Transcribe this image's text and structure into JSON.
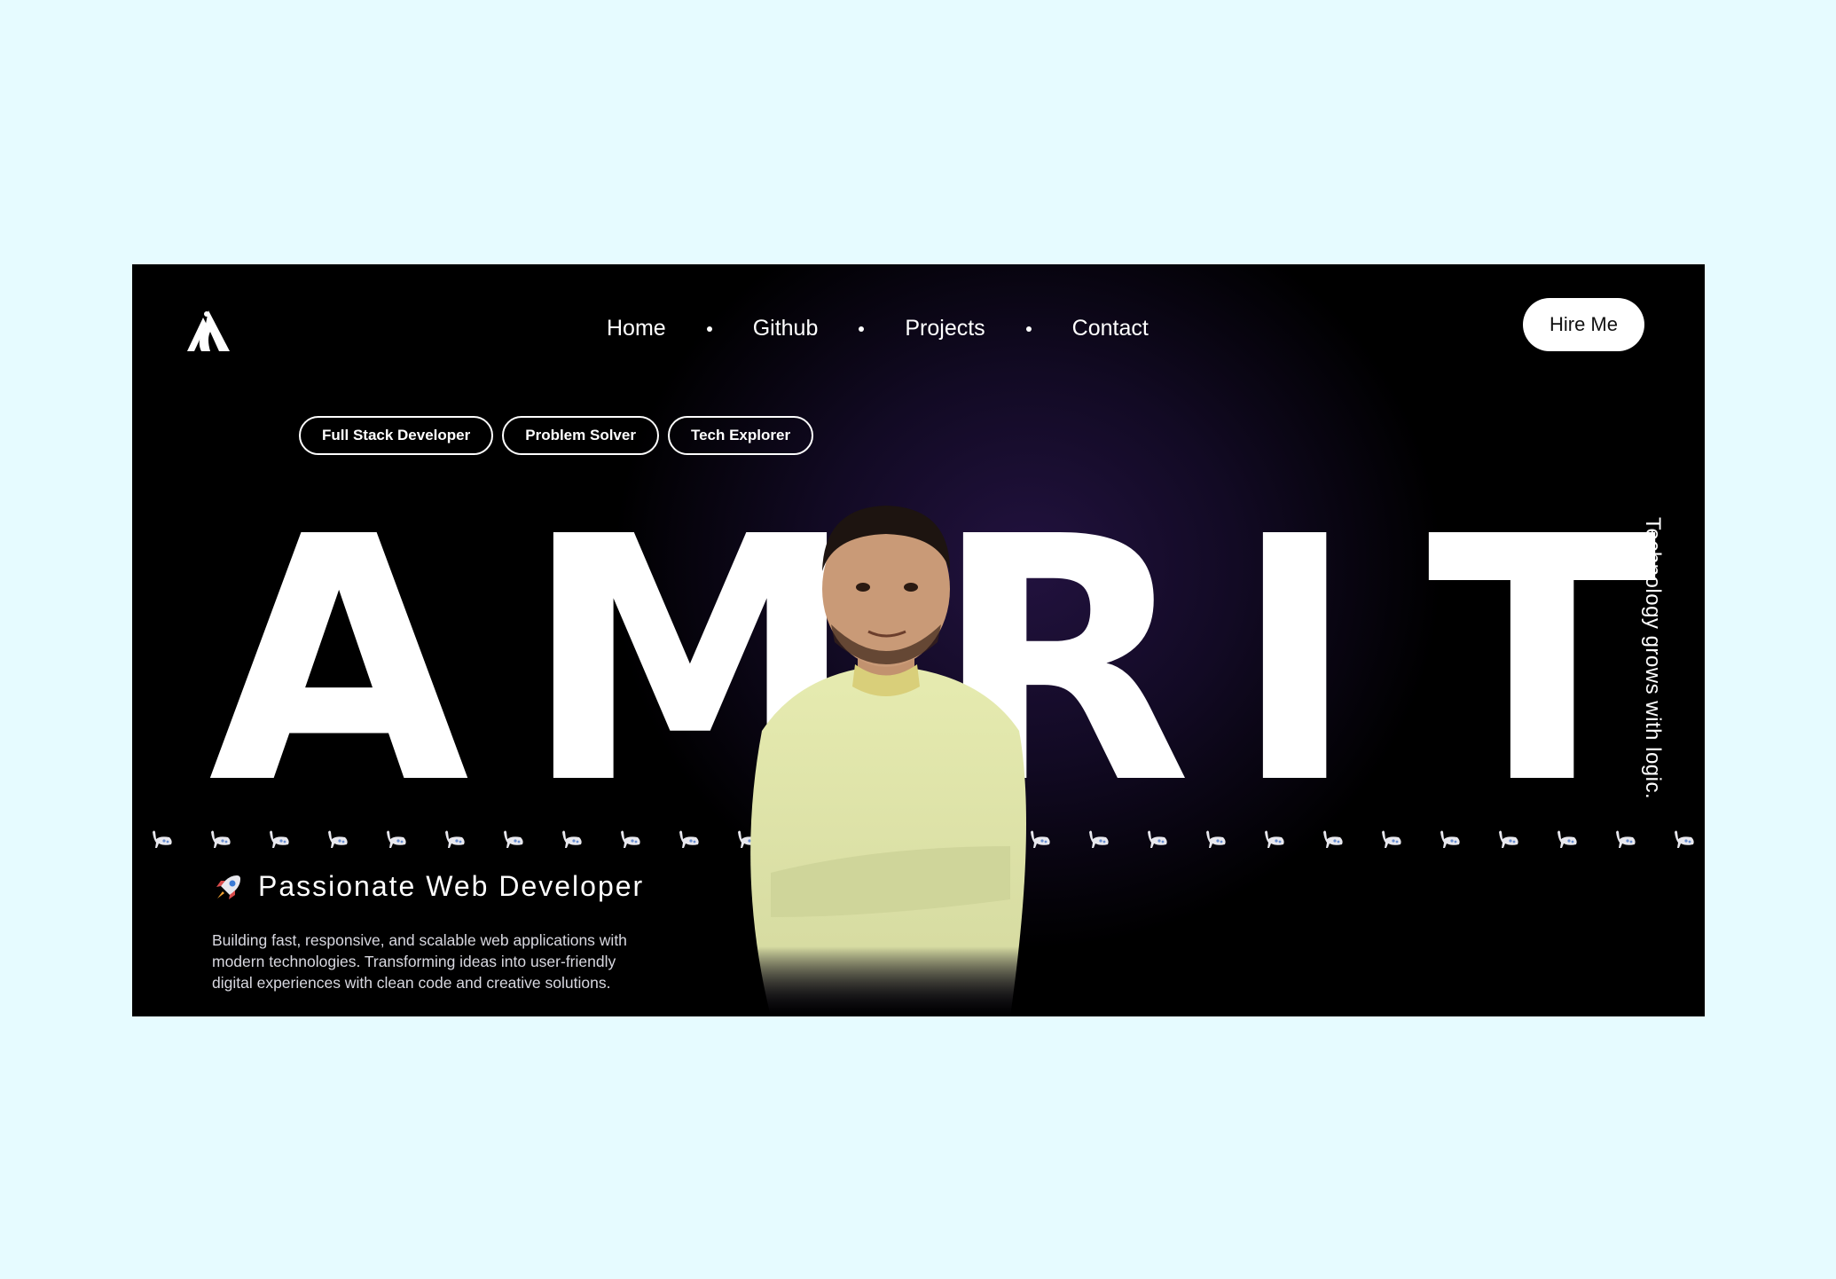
{
  "nav": {
    "logo_icon": "peacock-a-logo-icon",
    "links": [
      "Home",
      "Github",
      "Projects",
      "Contact"
    ],
    "hire_label": "Hire Me"
  },
  "tags": [
    "Full Stack Developer",
    "Problem Solver",
    "Tech Explorer"
  ],
  "name_letters": [
    "A",
    "M",
    "R",
    "I",
    "T"
  ],
  "side_text": "Technology grows with logic.",
  "headline": {
    "icon": "rocket-icon",
    "text": "Passionate Web Developer"
  },
  "description": "Building fast, responsive, and scalable web applications with modern technologies. Transforming ideas into user-friendly digital experiences with clean code and creative solutions.",
  "divider_icon": "peacock-icon",
  "colors": {
    "page_bg": "#e6fbff",
    "hero_bg": "#000000",
    "hero_glow": "#22123f",
    "text": "#ffffff"
  }
}
